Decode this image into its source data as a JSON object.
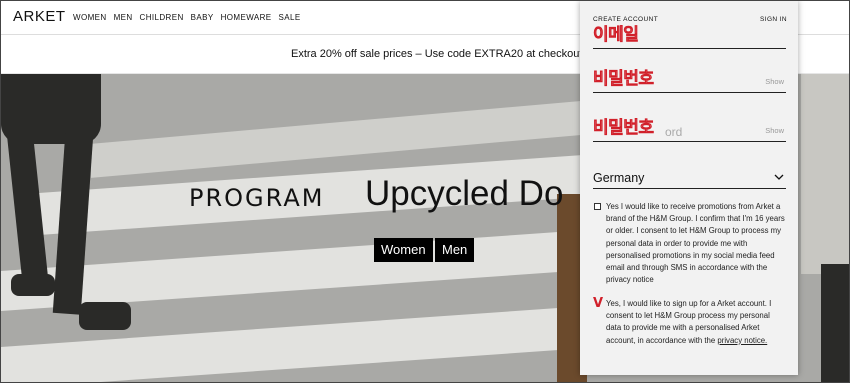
{
  "header": {
    "logo": "ARKET",
    "nav": [
      "WOMEN",
      "MEN",
      "CHILDREN",
      "BABY",
      "HOMEWARE",
      "SALE"
    ]
  },
  "promo": {
    "text": "Extra 20% off sale prices – Use code EXTRA20 at checkout"
  },
  "hero": {
    "program": "PROGRAM",
    "headline": "Upcycled Do",
    "buttons": [
      "Women",
      "Men"
    ]
  },
  "panel": {
    "create_account": "CREATE ACCOUNT",
    "sign_in": "SIGN IN",
    "email_label": "이메일",
    "password_label": "비밀번호",
    "password_show": "Show",
    "confirm_label": "비밀번호",
    "confirm_placeholder_tail": "ord",
    "confirm_show": "Show",
    "country": "Germany",
    "promo_consent": "Yes I would like to receive promotions from Arket a brand of the H&M Group. I confirm that I'm 16 years or older. I consent to let H&M Group to process my personal data in order to provide me with personalised promotions in my social media feed email and through SMS in accordance with the privacy notice",
    "account_consent_pre": "Yes, I would like to sign up for a Arket account. I consent to let H&M Group process my personal data to provide me with a personalised Arket account, in accordance with the ",
    "privacy_link": "privacy notice.",
    "v_mark": "V",
    "accent": "#d1202a"
  }
}
